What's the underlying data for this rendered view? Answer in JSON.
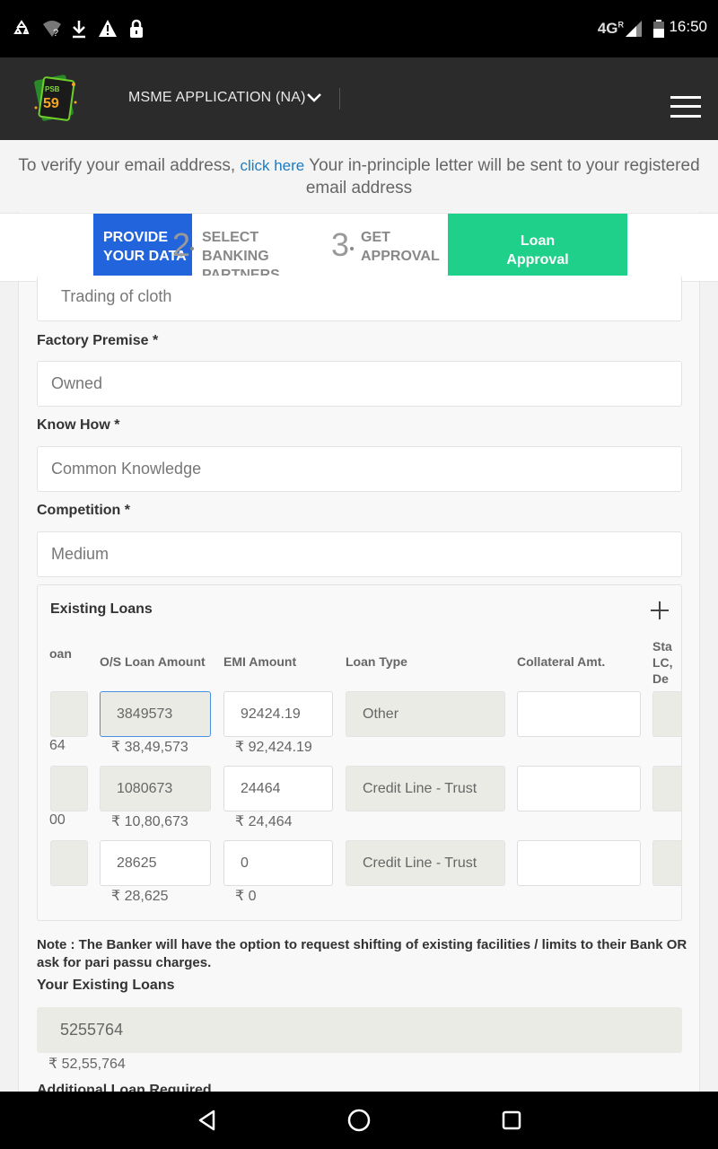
{
  "status_bar": {
    "time": "16:50",
    "network": "4G",
    "network_sup": "R"
  },
  "header": {
    "logo_text": "PSB",
    "logo_number": "59",
    "title": "MSME APPLICATION (NA)"
  },
  "verify_banner": {
    "text_before": "To verify your email address, ",
    "link": "click here",
    "text_after": " Your in-principle letter will be sent to your registered email address"
  },
  "stepper": {
    "steps": [
      {
        "num": "",
        "line1": "PROVIDE",
        "line2": "YOUR DATA"
      },
      {
        "num": "2",
        "line1": "SELECT",
        "line2": "BANKING PARTNERS"
      },
      {
        "num": "3",
        "line1": "GET",
        "line2": "APPROVAL"
      },
      {
        "num": "",
        "line1": "Loan",
        "line2": "Approval"
      }
    ]
  },
  "form": {
    "business_activity": {
      "value": "Trading of cloth"
    },
    "factory_premise": {
      "label": "Factory Premise *",
      "value": "Owned"
    },
    "know_how": {
      "label": "Know How *",
      "value": "Common Knowledge"
    },
    "competition": {
      "label": "Competition *",
      "value": "Medium"
    }
  },
  "existing_loans": {
    "title": "Existing Loans",
    "columns": {
      "loan": "oan",
      "os_amount": "O/S Loan Amount",
      "emi": "EMI Amount",
      "loan_type": "Loan Type",
      "collateral": "Collateral Amt.",
      "status_l1": "Sta",
      "status_l2": "LC,",
      "status_l3": "De"
    },
    "rows": [
      {
        "loan_fmt_tail": "64",
        "os_amount": "3849573",
        "os_fmt": "₹ 38,49,573",
        "emi": "92424.19",
        "emi_fmt": "₹ 92,424.19",
        "loan_type": "Other",
        "collateral": ""
      },
      {
        "loan_fmt_tail": "00",
        "os_amount": "1080673",
        "os_fmt": "₹ 10,80,673",
        "emi": "24464",
        "emi_fmt": "₹ 24,464",
        "loan_type": "Credit Line - Trust",
        "collateral": ""
      },
      {
        "loan_fmt_tail": "",
        "os_amount": "28625",
        "os_fmt": "₹ 28,625",
        "emi": "0",
        "emi_fmt": "₹ 0",
        "loan_type": "Credit Line - Trust",
        "collateral": ""
      }
    ]
  },
  "note": "Note : The Banker will have the option to request shifting of existing facilities / limits to their Bank OR ask for pari passu charges.",
  "your_existing_loans": {
    "label": "Your Existing Loans",
    "value": "5255764",
    "formatted": "₹ 52,55,764"
  },
  "next_label": "Additional Loan Required"
}
